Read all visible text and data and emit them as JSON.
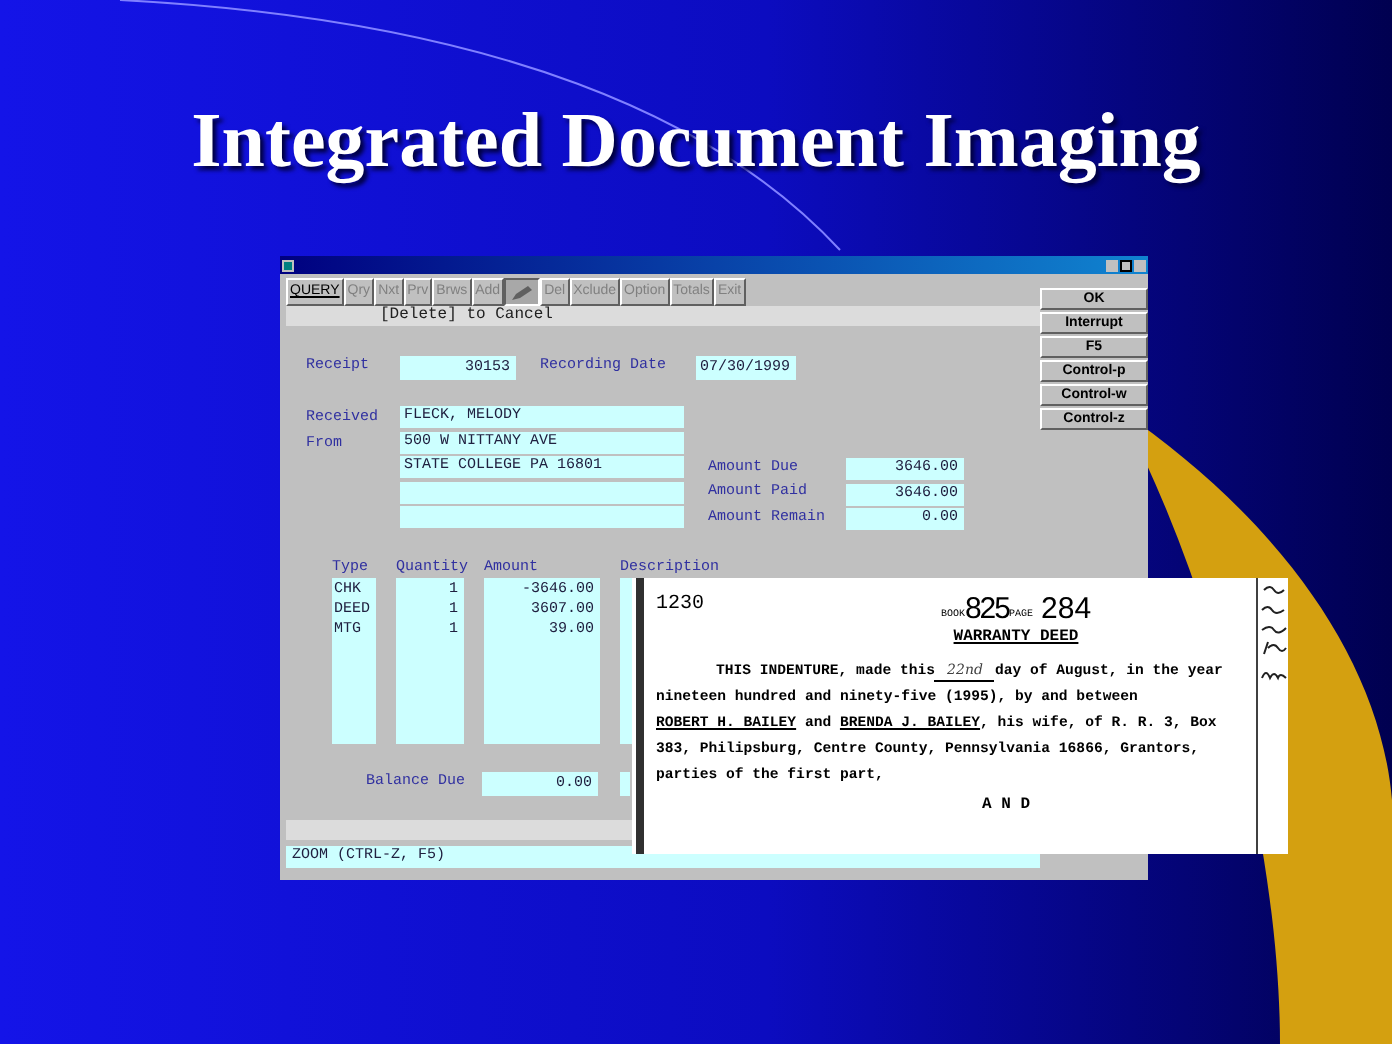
{
  "slide": {
    "title": "Integrated Document Imaging"
  },
  "window": {
    "toolbar": [
      {
        "kind": "text",
        "label": "QUERY",
        "disabled": false,
        "selected": false
      },
      {
        "kind": "text",
        "label": "Qry",
        "disabled": true,
        "selected": false
      },
      {
        "kind": "text",
        "label": "Nxt",
        "disabled": true,
        "selected": false
      },
      {
        "kind": "text",
        "label": "Prv",
        "disabled": true,
        "selected": false
      },
      {
        "kind": "text",
        "label": "Brws",
        "disabled": true,
        "selected": false
      },
      {
        "kind": "text",
        "label": "Add",
        "disabled": true,
        "selected": false
      },
      {
        "kind": "icon",
        "disabled": false,
        "selected": true
      },
      {
        "kind": "text",
        "label": "Del",
        "disabled": true,
        "selected": false
      },
      {
        "kind": "text",
        "label": "Xclude",
        "disabled": true,
        "selected": false
      },
      {
        "kind": "text",
        "label": "Option",
        "disabled": true,
        "selected": false
      },
      {
        "kind": "text",
        "label": "Totals",
        "disabled": true,
        "selected": false
      },
      {
        "kind": "text",
        "label": "Exit",
        "disabled": true,
        "selected": false
      }
    ],
    "message": "[Delete] to Cancel",
    "receipt": {
      "label": "Receipt",
      "value": "30153"
    },
    "recording_date": {
      "label": "Recording Date",
      "value": "07/30/1999"
    },
    "received_from": {
      "labels": [
        "Received",
        "From"
      ],
      "lines": [
        "FLECK, MELODY",
        "500 W NITTANY AVE",
        "STATE COLLEGE PA 16801"
      ]
    },
    "amounts": [
      {
        "label": "Amount Due",
        "value": "3646.00"
      },
      {
        "label": "Amount Paid",
        "value": "3646.00"
      },
      {
        "label": "Amount Remain",
        "value": "0.00"
      }
    ],
    "table": {
      "columns": [
        "Type",
        "Quantity",
        "Amount",
        "Description"
      ],
      "rows": [
        [
          "CHK",
          "1",
          "-3646.00"
        ],
        [
          "DEED",
          "1",
          "3607.00"
        ],
        [
          "MTG",
          "1",
          "39.00"
        ]
      ]
    },
    "balance_due": {
      "label": "Balance Due",
      "value": "0.00"
    },
    "status_bar": "ZOOM (CTRL-Z, F5)",
    "side_buttons": [
      "OK",
      "Interrupt",
      "F5",
      "Control-p",
      "Control-w",
      "Control-z"
    ]
  },
  "document": {
    "number": "1230",
    "book_label": "BOOK",
    "book": "825",
    "page_label": "PAGE",
    "page": "284",
    "heading": "WARRANTY DEED",
    "lines": [
      {
        "parts": [
          {
            "kind": "typed",
            "text": "THIS INDENTURE, made this"
          },
          {
            "kind": "handwritten",
            "text": "22nd"
          },
          {
            "kind": "typed",
            "text": "day of August, in the year"
          }
        ]
      },
      {
        "parts": [
          {
            "kind": "typed",
            "text": "nineteen hundred and ninety-five (1995), by and between"
          }
        ]
      },
      {
        "parts": [
          {
            "kind": "underlined",
            "text": "ROBERT H. BAILEY"
          },
          {
            "kind": "typed",
            "text": " and "
          },
          {
            "kind": "underlined",
            "text": "BRENDA J. BAILEY"
          },
          {
            "kind": "typed",
            "text": ", his wife, of R. R. 3, Box"
          }
        ]
      },
      {
        "parts": [
          {
            "kind": "typed",
            "text": "383, Philipsburg, Centre County, Pennsylvania 16866, Grantors,"
          }
        ]
      },
      {
        "parts": [
          {
            "kind": "typed",
            "text": "parties of the first part,"
          }
        ]
      }
    ],
    "footer": "A N D"
  }
}
